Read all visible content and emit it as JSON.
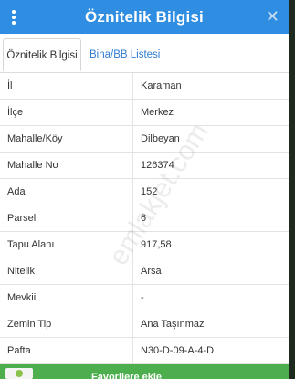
{
  "header": {
    "title": "Öznitelik Bilgisi",
    "close_symbol": "✕"
  },
  "tabs": [
    {
      "label": "Öznitelik Bilgisi",
      "active": true
    },
    {
      "label": "Bina/BB Listesi",
      "active": false
    }
  ],
  "rows": [
    {
      "key": "İl",
      "value": "Karaman"
    },
    {
      "key": "İlçe",
      "value": "Merkez"
    },
    {
      "key": "Mahalle/Köy",
      "value": "Dilbeyan"
    },
    {
      "key": "Mahalle No",
      "value": "126374"
    },
    {
      "key": "Ada",
      "value": "152"
    },
    {
      "key": "Parsel",
      "value": "6"
    },
    {
      "key": "Tapu Alanı",
      "value": "917,58"
    },
    {
      "key": "Nitelik",
      "value": "Arsa"
    },
    {
      "key": "Mevkii",
      "value": "-"
    },
    {
      "key": "Zemin Tip",
      "value": "Ana Taşınmaz"
    },
    {
      "key": "Pafta",
      "value": "N30-D-09-A-4-D"
    }
  ],
  "footer": {
    "label": "Favorilere ekle"
  },
  "watermark": "emlakjet.com",
  "colors": {
    "header": "#2f8de2",
    "tab_link": "#2f7bd0",
    "footer": "#4cae4c"
  },
  "icons": {
    "menu": "vertical-dots-icon",
    "close": "close-icon"
  }
}
